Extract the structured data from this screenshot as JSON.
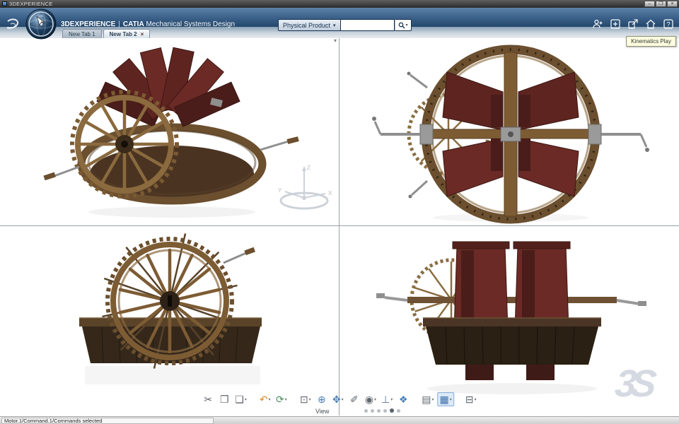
{
  "window": {
    "title": "3DEXPERIENCE",
    "minimize": "–",
    "maximize": "❐",
    "close": "×"
  },
  "header": {
    "brand": "3DEXPERIENCE",
    "separator": "|",
    "app": "CATIA",
    "module": "Mechanical Systems Design",
    "search_scope": "Physical Product",
    "scope_caret": "▾",
    "search_value": "",
    "search_placeholder": "",
    "search_caret": "▾",
    "help_glyph": "?"
  },
  "tabs": {
    "close_glyph": "×",
    "items": [
      {
        "label": "New Tab 1",
        "active": false
      },
      {
        "label": "New Tab 2",
        "active": true
      }
    ]
  },
  "tooltip": {
    "text": "Kinematics Play"
  },
  "compass": {
    "x": "X",
    "y": "Y",
    "z": "Z"
  },
  "toolbar": {
    "label": "View",
    "caret_glyph": "▾",
    "items": [
      {
        "name": "cut",
        "glyph": "✂",
        "style": "color:#5f666d"
      },
      {
        "name": "copy",
        "glyph": "❐",
        "style": "color:#5f666d"
      },
      {
        "name": "paste",
        "glyph": "❏",
        "style": "color:#5f666d",
        "caret": true
      },
      {
        "sep": true
      },
      {
        "name": "undo",
        "glyph": "↶",
        "style": "color:#d98a1f",
        "caret": true
      },
      {
        "name": "update",
        "glyph": "⟳",
        "style": "color:#4f8f62",
        "caret": true
      },
      {
        "sep": true
      },
      {
        "name": "reframe",
        "glyph": "⊡",
        "style": "color:#5f666d",
        "caret": true
      },
      {
        "name": "fit-all",
        "glyph": "⊕",
        "style": "color:#4a7fb5"
      },
      {
        "name": "pan",
        "glyph": "✥",
        "style": "color:#4a7fb5",
        "caret": true
      },
      {
        "name": "measure",
        "glyph": "✐",
        "style": "color:#5f666d"
      },
      {
        "name": "zoom",
        "glyph": "◉",
        "style": "color:#5f666d",
        "caret": true
      },
      {
        "name": "normal-view",
        "glyph": "⊥",
        "style": "color:#5f7a95",
        "caret": true
      },
      {
        "name": "iso-view",
        "glyph": "❖",
        "style": "color:#4a7fb5"
      },
      {
        "sep": true
      },
      {
        "name": "capture",
        "glyph": "▤",
        "style": "color:#5f666d",
        "caret": true
      },
      {
        "name": "multi-view",
        "glyph": "▦",
        "style": "color:#3d6ea8",
        "caret": true,
        "active": true
      },
      {
        "sep": true
      },
      {
        "name": "design-tree",
        "glyph": "⊟",
        "style": "color:#5f666d",
        "caret": true
      }
    ]
  },
  "pager": {
    "count": 6,
    "active": 4
  },
  "status": {
    "text": "Motor.1/Command.1/Commands selected"
  },
  "watermark": {
    "text": "3S"
  },
  "colors": {
    "header_top": "#5d82a8",
    "header_bottom": "#24476b",
    "wood": "#7d5c34",
    "wood_dark": "#4a3421",
    "paddle_red": "#5e2420",
    "hull": "#35281b",
    "accent_blue": "#4a7fb5",
    "undo_orange": "#d98a1f"
  }
}
